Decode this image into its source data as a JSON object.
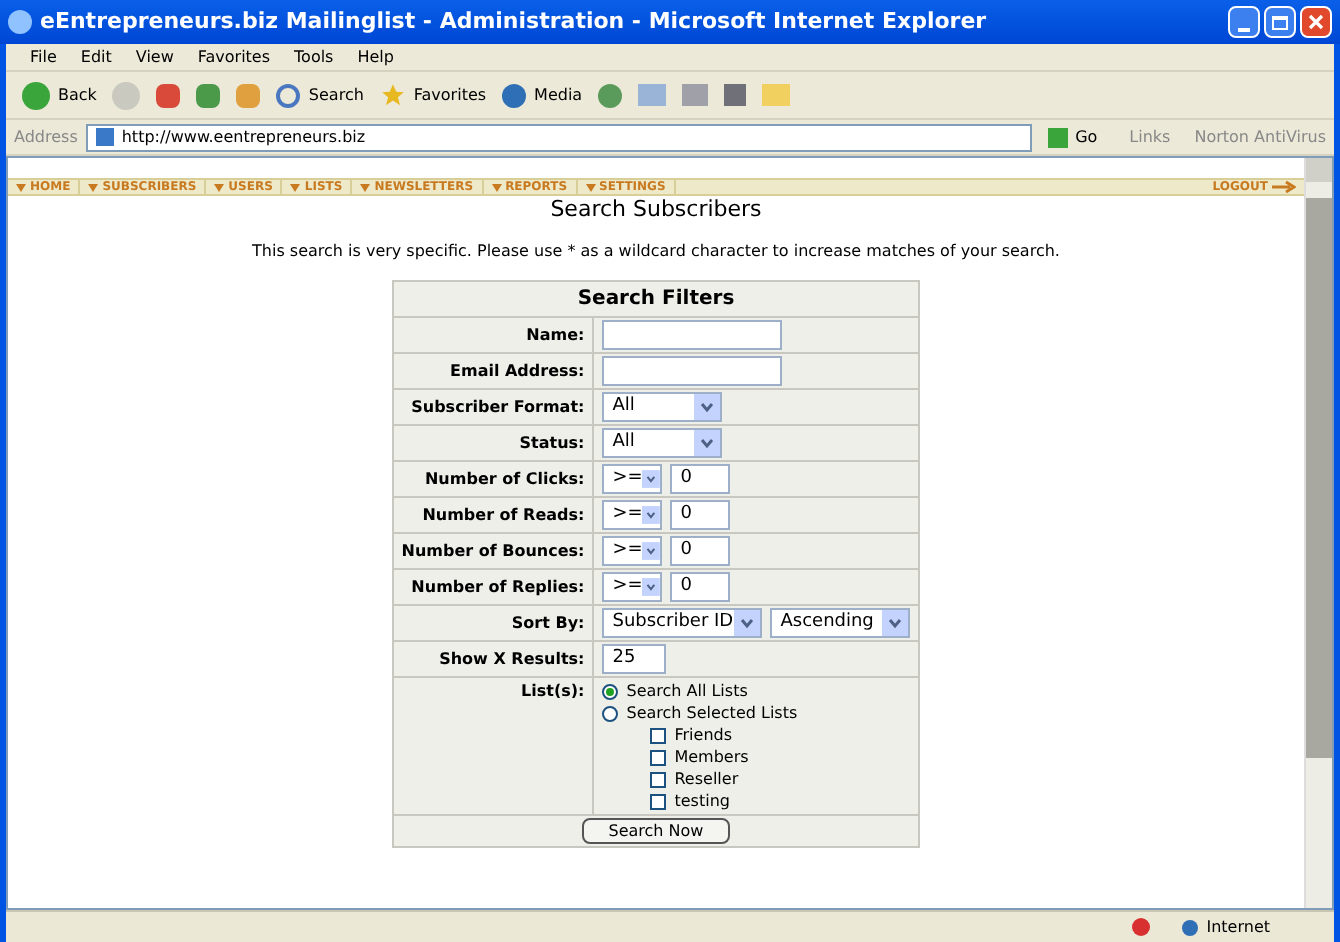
{
  "window": {
    "title": "eEntrepreneurs.biz Mailinglist - Administration - Microsoft Internet Explorer"
  },
  "menu": [
    "File",
    "Edit",
    "View",
    "Favorites",
    "Tools",
    "Help"
  ],
  "toolbar": {
    "back": "Back",
    "search": "Search",
    "favorites": "Favorites",
    "media": "Media"
  },
  "address": {
    "label": "Address",
    "value": "http://www.eentrepreneurs.biz",
    "go": "Go",
    "links": "Links",
    "norton": "Norton AntiVirus"
  },
  "nav": [
    "HOME",
    "SUBSCRIBERS",
    "USERS",
    "LISTS",
    "NEWSLETTERS",
    "REPORTS",
    "SETTINGS"
  ],
  "logout": "LOGOUT",
  "heading": "Search Subscribers",
  "note": "This search is very specific. Please use * as a wildcard character to increase matches of your search.",
  "filters": {
    "title": "Search Filters",
    "rows": [
      {
        "kind": "text",
        "label": "Name:",
        "value": ""
      },
      {
        "kind": "text",
        "label": "Email Address:",
        "value": ""
      },
      {
        "kind": "select",
        "label": "Subscriber Format:",
        "value": "All"
      },
      {
        "kind": "select",
        "label": "Status:",
        "value": "All"
      },
      {
        "kind": "compare",
        "label": "Number of Clicks:",
        "op": ">=",
        "value": "0"
      },
      {
        "kind": "compare",
        "label": "Number of Reads:",
        "op": ">=",
        "value": "0"
      },
      {
        "kind": "compare",
        "label": "Number of Bounces:",
        "op": ">=",
        "value": "0"
      },
      {
        "kind": "compare",
        "label": "Number of Replies:",
        "op": ">=",
        "value": "0"
      },
      {
        "kind": "sort",
        "label": "Sort By:",
        "field": "Subscriber ID",
        "order": "Ascending"
      },
      {
        "kind": "number",
        "label": "Show X Results:",
        "value": "25"
      }
    ],
    "lists": {
      "label": "List(s):",
      "options": [
        {
          "label": "Search All Lists",
          "selected": true
        },
        {
          "label": "Search Selected Lists",
          "selected": false
        }
      ],
      "items": [
        {
          "label": "Friends",
          "checked": false
        },
        {
          "label": "Members",
          "checked": false
        },
        {
          "label": "Reseller",
          "checked": false
        },
        {
          "label": "testing",
          "checked": false
        }
      ]
    },
    "submit": "Search Now"
  },
  "status": {
    "zone": "Internet"
  }
}
